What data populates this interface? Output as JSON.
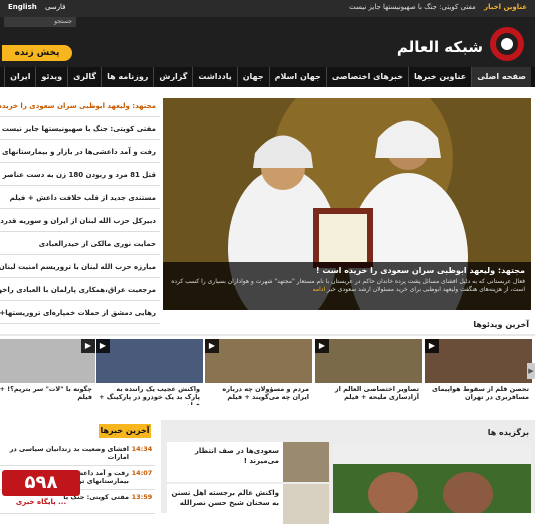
{
  "topbar": {
    "lang_en": "English",
    "lang_fa": "فارسی",
    "news_label": "عناوين اخبار",
    "news_text": "مفتی کویتی: جنگ با صهیونیستها جایز نیست"
  },
  "header": {
    "search_placeholder": "جستجو",
    "live_label": "پخش زنده",
    "logo_name": "شبکه العالم"
  },
  "nav": {
    "items": [
      "صفحه اصلی",
      "عناوين خبرها",
      "خبرهای اختصاصی",
      "جهان اسلام",
      "جهان",
      "یادداشت",
      "گزارش",
      "روزنامه ها",
      "گالری",
      "ویدئو",
      "ایران"
    ]
  },
  "headlines": [
    "مجتهد: ولیعهد ابوظبی سران سعودی را خریده است !",
    "مفتی کویتی: جنگ با صهیونیستها جایز نیست",
    "رفت و آمد داعشی‌ها در بازار و بیمارستانهای ترکیه",
    "قتل 81 مرد و ربودن 180 زن به دست عناصر داعش",
    "مستندی جدید از قلب خلافت داعش + فیلم",
    "دبیرکل حزب الله لبنان از ایران و سوریه قدردانی کرد",
    "حمایت نوری مالکی از حیدرالعبادی",
    "مبارزه حزب الله لبنان با تروریسم امنیت لبنان را تضمین کرد",
    "مرجعیت عراق،همکاری پارلمان با العبادی راخواستارشد",
    "رهایی دمشق از حملات خمپاره‌ای تروریستها+ ویدئو"
  ],
  "hero": {
    "title": "مجتهد: ولیعهد ابوظبی سران سعودی را خریده است !",
    "desc": "فعال عربستانی که به دلیل افشای مسائل پشت پرده خاندان حاکم در عربستان با نام مستعار \"مجتهد\" شهرت و هواداران بسیاری را کسب کرده است، از هزینه‌های هنگفت ولیعهد ابوظبی برای خرید مسئولان ارشد سعودی خبر",
    "more": "ادامه"
  },
  "videos": {
    "title": "آخرین ویدئوها",
    "items": [
      "تحصن قلم از سقوط هواپیمای مسافربری در تهران",
      "تصاویر اختصاصی العالم از آزادسازی ملیحه + فیلم",
      "مردم و مسؤولان چه درباره ایران چه می‌گویند + فیلم",
      "واکنش عجیب یک راننده به پارک بد یک خودرو در پارکینگ + فیلم",
      "چگونه با \"لات\" سر بتریم؟! + فیلم"
    ]
  },
  "latest": {
    "tab": "آخرین خبرها",
    "items": [
      {
        "time": "14:34",
        "text": "افشای وضعیت بد زندانیان سیاسی در امارات"
      },
      {
        "time": "14:07",
        "text": "رفت و آمد داعشی‌ها در بازار و بیمارستانهای ترکیه"
      },
      {
        "time": "13:59",
        "text": "مفتی کویتی: جنگ با"
      }
    ]
  },
  "watermark": {
    "number": "۵۹۸",
    "site": "پایگاه خبری ..."
  },
  "picks": {
    "title": "برگزیده ها",
    "items": [
      "سعودی‌ها در صف انتظار می‌میرند !",
      "واکنش عالم برجسته اهل تسنن به سخنان شیخ حسن نصرالله"
    ]
  },
  "colors": {
    "accent": "#f7b51e",
    "nav_bg": "#121212",
    "highlight": "#c65a00"
  }
}
